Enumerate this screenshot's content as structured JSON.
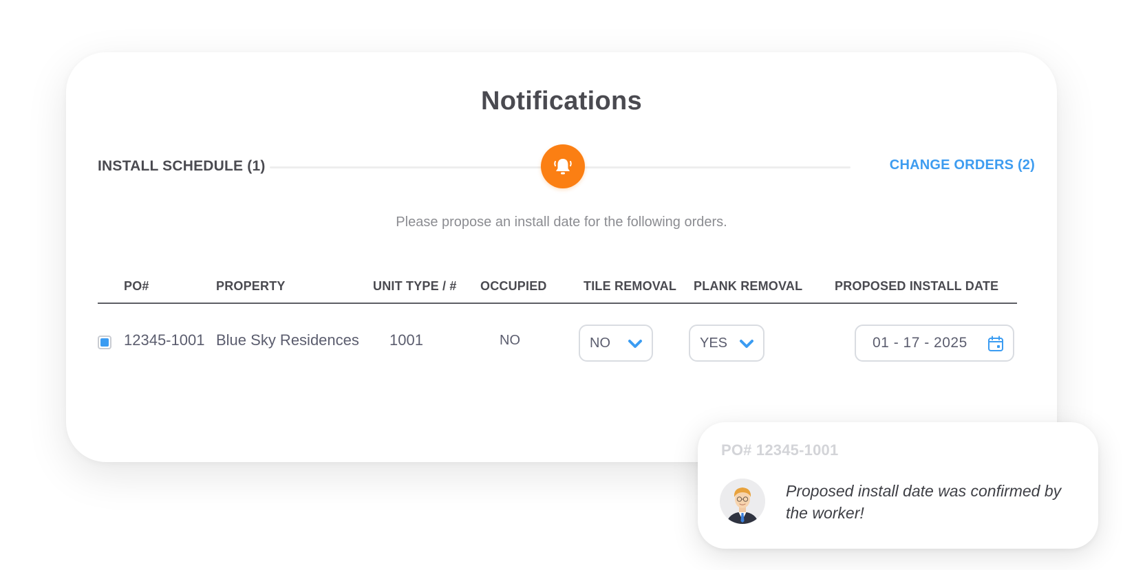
{
  "title": "Notifications",
  "tabs": {
    "left": "INSTALL SCHEDULE (1)",
    "right": "CHANGE ORDERS (2)"
  },
  "bell_icon": "bell-ringing-icon",
  "instructions": "Please propose an install date for the following orders.",
  "table": {
    "headers": {
      "po": "PO#",
      "property": "PROPERTY",
      "unit": "UNIT TYPE / #",
      "occupied": "OCCUPIED",
      "tile": "TILE REMOVAL",
      "plank": "PLANK REMOVAL",
      "date": "PROPOSED INSTALL DATE"
    },
    "rows": [
      {
        "checked": true,
        "po": "12345-1001",
        "property": "Blue Sky Residences",
        "unit": "1001",
        "occupied": "NO",
        "tile_removal": "NO",
        "plank_removal": "YES",
        "install_date": "01 - 17 - 2025"
      }
    ]
  },
  "toast": {
    "title": "PO# 12345-1001",
    "message": "Proposed install date was confirmed by the worker!"
  },
  "colors": {
    "accent_orange": "#fb7f13",
    "accent_blue": "#3d9cf0",
    "text_dark": "#4a4a50",
    "text_muted": "#8b8c91"
  }
}
